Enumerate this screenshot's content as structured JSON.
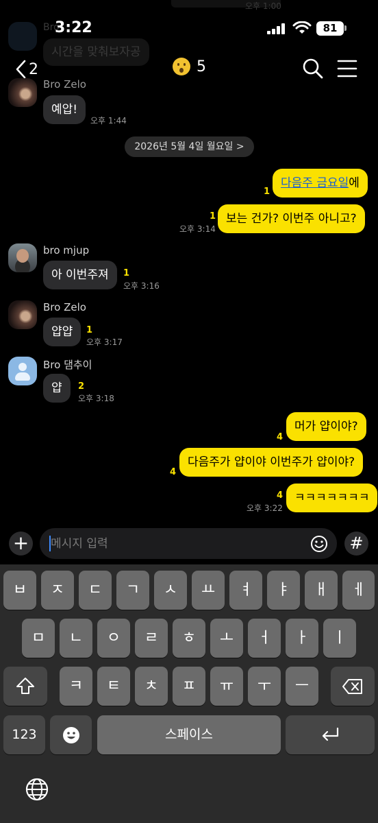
{
  "status_bar": {
    "time": "3:22",
    "battery": "81"
  },
  "ghost_prev": {
    "sender": "Bro",
    "message": "시간을 맞춰보자공",
    "top_time": "오후 1:00"
  },
  "header": {
    "back_count": "2",
    "member_count": "5",
    "emoji": "astonished-face"
  },
  "date_divider": "2026년 5월 4일 월요일 >",
  "messages": [
    {
      "sender": "Bro Zelo",
      "text": "예압!",
      "time": "오후 1:44"
    },
    {
      "text_link": "다음주 금요일",
      "text_after": "에",
      "unread": "1"
    },
    {
      "text": "보는 건가? 이번주 아니고?",
      "unread": "1",
      "time": "오후 3:14"
    },
    {
      "sender": "bro mjup",
      "text": "아 이번주져",
      "unread": "1",
      "time": "오후 3:16"
    },
    {
      "sender": "Bro Zelo",
      "text": "얍얍",
      "unread": "1",
      "time": "오후 3:17"
    },
    {
      "sender": "Bro 댐추이",
      "text": "얍",
      "unread": "2",
      "time": "오후 3:18"
    },
    {
      "text": "머가 얍이야?",
      "unread": "4"
    },
    {
      "text": "다음주가 얍이야 이번주가 얍이야?",
      "unread": "4"
    },
    {
      "text": "ㅋㅋㅋㅋㅋㅋㅋ",
      "unread": "4",
      "time": "오후 3:22"
    }
  ],
  "input": {
    "placeholder": "메시지 입력",
    "value": ""
  },
  "keyboard": {
    "row1": [
      "ㅂ",
      "ㅈ",
      "ㄷ",
      "ㄱ",
      "ㅅ",
      "ㅛ",
      "ㅕ",
      "ㅑ",
      "ㅐ",
      "ㅔ"
    ],
    "row2": [
      "ㅁ",
      "ㄴ",
      "ㅇ",
      "ㄹ",
      "ㅎ",
      "ㅗ",
      "ㅓ",
      "ㅏ",
      "ㅣ"
    ],
    "row3": [
      "ㅋ",
      "ㅌ",
      "ㅊ",
      "ㅍ",
      "ㅠ",
      "ㅜ",
      "ㅡ"
    ],
    "numbers_label": "123",
    "space_label": "스페이스"
  },
  "colors": {
    "my_bubble": "#fae100",
    "other_bubble": "#2c2c2e",
    "unread": "#fae100",
    "background": "#000000"
  }
}
